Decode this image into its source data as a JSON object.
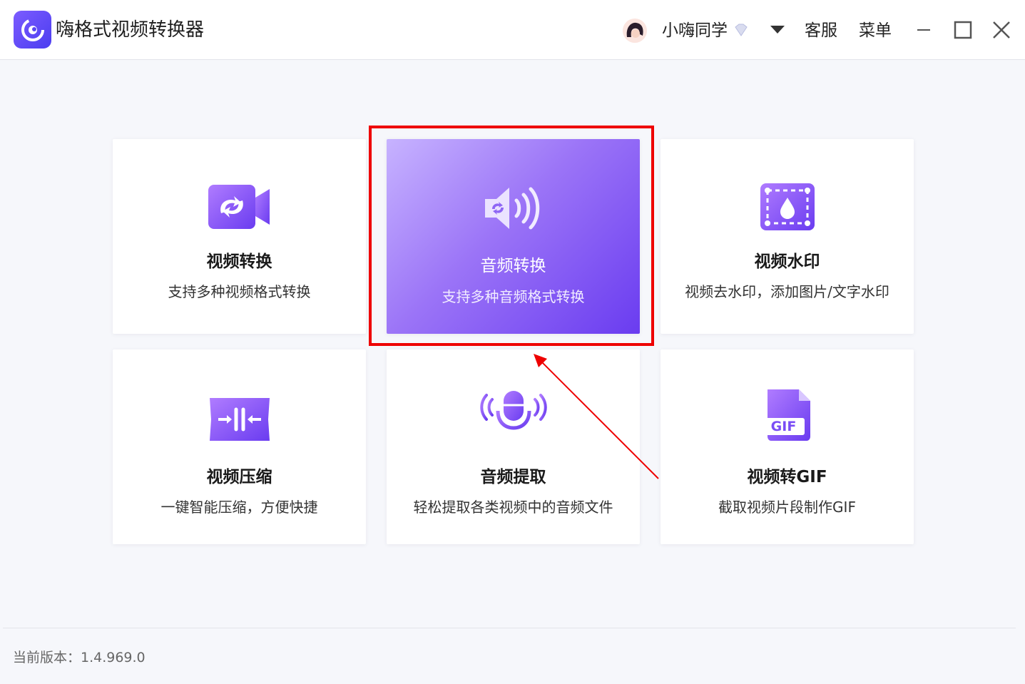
{
  "header": {
    "app_title": "嗨格式视频转换器",
    "username": "小嗨同学",
    "support_label": "客服",
    "menu_label": "菜单"
  },
  "cards": [
    {
      "title": "视频转换",
      "desc": "支持多种视频格式转换",
      "icon": "video-convert-icon"
    },
    {
      "title": "音频转换",
      "desc": "支持多种音频格式转换",
      "icon": "audio-convert-icon",
      "selected": true
    },
    {
      "title": "视频水印",
      "desc": "视频去水印，添加图片/文字水印",
      "icon": "watermark-icon"
    },
    {
      "title": "视频压缩",
      "desc": "一键智能压缩，方便快捷",
      "icon": "compress-icon"
    },
    {
      "title": "音频提取",
      "desc": "轻松提取各类视频中的音频文件",
      "icon": "microphone-icon"
    },
    {
      "title": "视频转GIF",
      "desc": "截取视频片段制作GIF",
      "icon": "gif-icon",
      "icon_text": "GIF"
    }
  ],
  "footer": {
    "version_label": "当前版本：1.4.969.0"
  },
  "colors": {
    "accent": "#7a4df5",
    "highlight": "#ee0000"
  }
}
